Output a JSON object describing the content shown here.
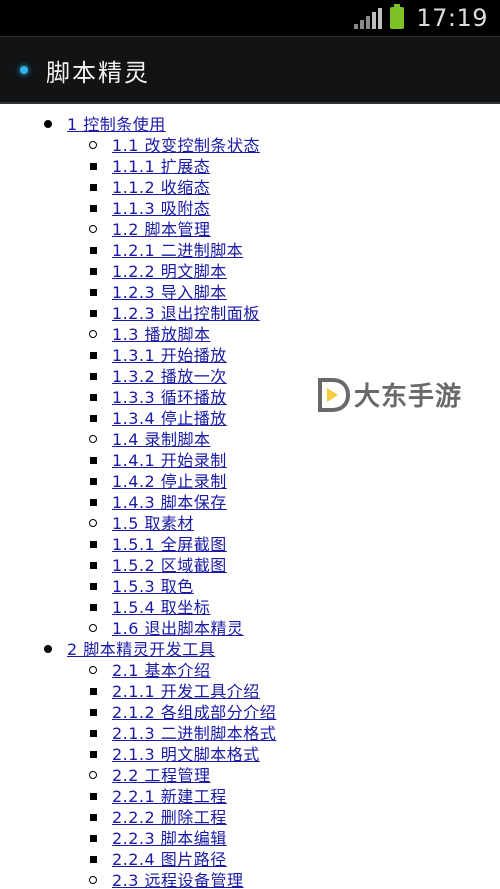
{
  "status_bar": {
    "time": "17:19",
    "icons": [
      "signal-icon",
      "battery-icon"
    ]
  },
  "app_bar": {
    "title": "脚本精灵"
  },
  "toc": [
    {
      "label": "1 控制条使用",
      "children": [
        {
          "label": "1.1 改变控制条状态",
          "children": [
            {
              "label": "1.1.1 扩展态"
            },
            {
              "label": "1.1.2 收缩态"
            },
            {
              "label": "1.1.3 吸附态"
            }
          ]
        },
        {
          "label": "1.2 脚本管理",
          "children": [
            {
              "label": "1.2.1 二进制脚本"
            },
            {
              "label": "1.2.2 明文脚本"
            },
            {
              "label": "1.2.3 导入脚本"
            },
            {
              "label": "1.2.3 退出控制面板"
            }
          ]
        },
        {
          "label": "1.3 播放脚本",
          "children": [
            {
              "label": "1.3.1 开始播放"
            },
            {
              "label": "1.3.2 播放一次"
            },
            {
              "label": "1.3.3 循环播放"
            },
            {
              "label": "1.3.4 停止播放"
            }
          ]
        },
        {
          "label": "1.4 录制脚本",
          "children": [
            {
              "label": "1.4.1 开始录制"
            },
            {
              "label": "1.4.2 停止录制"
            },
            {
              "label": "1.4.3 脚本保存"
            }
          ]
        },
        {
          "label": "1.5 取素材",
          "children": [
            {
              "label": "1.5.1 全屏截图"
            },
            {
              "label": "1.5.2 区域截图"
            },
            {
              "label": "1.5.3 取色"
            },
            {
              "label": "1.5.4 取坐标"
            }
          ]
        },
        {
          "label": "1.6 退出脚本精灵",
          "children": []
        }
      ]
    },
    {
      "label": "2 脚本精灵开发工具",
      "children": [
        {
          "label": "2.1 基本介绍",
          "children": [
            {
              "label": "2.1.1 开发工具介绍"
            },
            {
              "label": "2.1.2 各组成部分介绍"
            },
            {
              "label": "2.1.3 二进制脚本格式"
            },
            {
              "label": "2.1.3 明文脚本格式"
            }
          ]
        },
        {
          "label": "2.2 工程管理",
          "children": [
            {
              "label": "2.2.1 新建工程"
            },
            {
              "label": "2.2.2 删除工程"
            },
            {
              "label": "2.2.3 脚本编辑"
            },
            {
              "label": "2.2.4 图片路径"
            }
          ]
        },
        {
          "label": "2.3 远程设备管理",
          "children": []
        }
      ]
    }
  ],
  "watermark": {
    "text": "大东手游",
    "icon": "dadong-logo-icon"
  },
  "colors": {
    "link": "#1a1aa6",
    "status_bg": "#000000",
    "app_bar_bg": "#111315",
    "accent_dot": "#31b6e7",
    "battery": "#7ec225"
  }
}
